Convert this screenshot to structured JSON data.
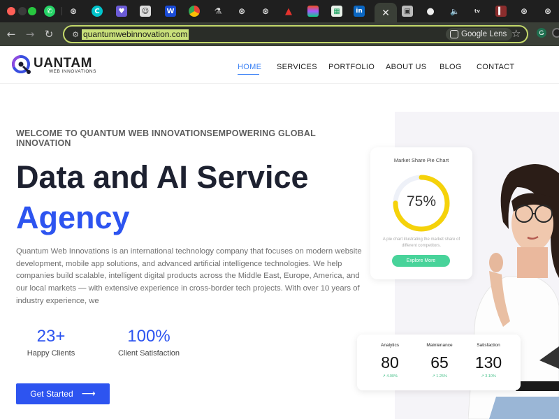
{
  "browser": {
    "url": "quantumwebinnovation.com",
    "lens_label": "Google Lens",
    "active_tab_icon": "close-icon",
    "tab_icons": [
      "whatsapp-icon",
      "chatgpt-icon",
      "canva-icon",
      "heart-icon",
      "app-icon",
      "wordpress-icon",
      "chrome-icon",
      "flask-icon",
      "openai-icon",
      "openai-icon",
      "adobe-icon",
      "figma-icon",
      "sheets-icon",
      "linkedin-icon",
      "tab-close-icon",
      "image-icon",
      "github-icon",
      "audio-icon",
      "appletv-icon",
      "image-icon",
      "openai-icon"
    ]
  },
  "site": {
    "logo_text": "UANTAM",
    "logo_sub": "WEB INNOVATIONS",
    "nav": [
      {
        "label": "HOME",
        "active": true
      },
      {
        "label": "SERVICES",
        "active": false
      },
      {
        "label": "PORTFOLIO",
        "active": false
      },
      {
        "label": "ABOUT US",
        "active": false
      },
      {
        "label": "BLOG",
        "active": false
      },
      {
        "label": "CONTACT",
        "active": false
      }
    ]
  },
  "hero": {
    "welcome": "WELCOME TO QUANTUM WEB INNOVATIONSEMPOWERING GLOBAL INNOVATION",
    "headline_line1": "Data and AI Service",
    "headline_line2": "Agency",
    "intro": "Quantum Web Innovations is an international technology company that focuses on modern website development, mobile app solutions, and advanced artificial intelligence technologies. We help companies build scalable, intelligent digital products across the Middle East, Europe, America, and our local markets — with extensive experience in cross-border tech projects. With over 10 years of industry experience, we",
    "stats": [
      {
        "value": "23+",
        "label": "Happy Clients"
      },
      {
        "value": "100%",
        "label": "Client Satisfaction"
      }
    ],
    "cta_label": "Get Started",
    "cta_icon": "arrow-right-icon"
  },
  "pie_card": {
    "title": "Market Share Pie Chart",
    "percent_text": "75%",
    "percent_value": 75,
    "description": "A pie chart illustrating the market share of different competitors.",
    "button_label": "Explore More",
    "colors": {
      "ring": "#f5d20a",
      "track": "#eef1f8"
    }
  },
  "stats_card": [
    {
      "label": "Analytics",
      "value": "80",
      "delta": "4.00%"
    },
    {
      "label": "Maintenance",
      "value": "65",
      "delta": "1.25%"
    },
    {
      "label": "Satisfaction",
      "value": "130",
      "delta": "3.10%"
    }
  ],
  "colors": {
    "accent": "#2d54f0",
    "nav_active": "#3b82f6",
    "green": "#48d39a"
  }
}
